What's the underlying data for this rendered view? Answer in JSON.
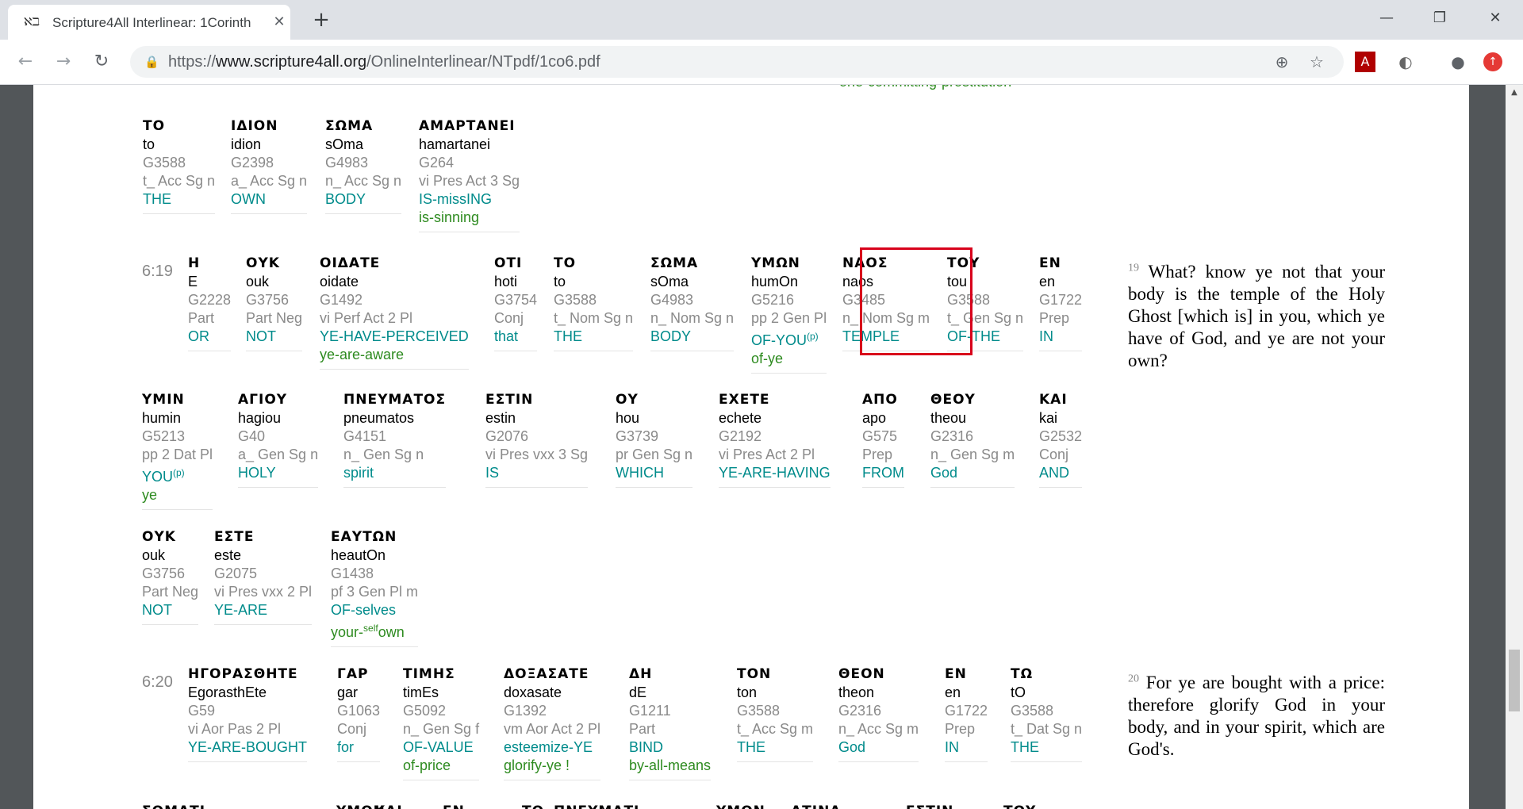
{
  "browser": {
    "tab_title": "Scripture4All Interlinear: 1Corinth",
    "tab_favicon": "ℵℶ",
    "url_scheme": "https://",
    "url_host": "www.scripture4all.org",
    "url_path": "/OnlineInterlinear/NTpdf/1co6.pdf"
  },
  "page": {
    "partial_top_text": "one-committing-prostitution",
    "verses": [
      {
        "ref": "",
        "words": [
          {
            "gk": "ΤΟ",
            "tr": "to",
            "st": "G3588",
            "ps": "t_ Acc Sg n",
            "en": "THE",
            "al": ""
          },
          {
            "gk": "ΙΔΙΟΝ",
            "tr": "idion",
            "st": "G2398",
            "ps": "a_ Acc Sg n",
            "en": "OWN",
            "al": ""
          },
          {
            "gk": "ΣΩΜΑ",
            "tr": "sOma",
            "st": "G4983",
            "ps": "n_ Acc Sg n",
            "en": "BODY",
            "al": ""
          },
          {
            "gk": "ΑΜΑΡΤΑΝΕΙ",
            "tr": "hamartanei",
            "st": "G264",
            "ps": "vi Pres Act 3 Sg",
            "en": "IS-missING",
            "al": "is-sinning"
          }
        ]
      },
      {
        "ref": "6:19",
        "words": [
          {
            "gk": "Η",
            "tr": "E",
            "st": "G2228",
            "ps": "Part",
            "en": "OR",
            "al": ""
          },
          {
            "gk": "ΟΥΚ",
            "tr": "ouk",
            "st": "G3756",
            "ps": "Part Neg",
            "en": "NOT",
            "al": ""
          },
          {
            "gk": "ΟΙΔΑΤΕ",
            "tr": "oidate",
            "st": "G1492",
            "ps": "vi Perf Act 2 Pl",
            "en": "YE-HAVE-PERCEIVED",
            "al": "ye-are-aware"
          },
          {
            "gk": "ΟΤΙ",
            "tr": "hoti",
            "st": "G3754",
            "ps": "Conj",
            "en": "that",
            "al": ""
          },
          {
            "gk": "ΤΟ",
            "tr": "to",
            "st": "G3588",
            "ps": "t_ Nom Sg n",
            "en": "THE",
            "al": ""
          },
          {
            "gk": "ΣΩΜΑ",
            "tr": "sOma",
            "st": "G4983",
            "ps": "n_ Nom Sg n",
            "en": "BODY",
            "al": ""
          },
          {
            "gk": "ΥΜΩΝ",
            "tr": "humOn",
            "st": "G5216",
            "ps": "pp 2 Gen Pl",
            "en": "OF-YOU(p)",
            "al": "of-ye"
          },
          {
            "gk": "ΝΑΟΣ",
            "tr": "naos",
            "st": "G3485",
            "ps": "n_ Nom Sg m",
            "en": "TEMPLE",
            "al": ""
          },
          {
            "gk": "ΤΟΥ",
            "tr": "tou",
            "st": "G3588",
            "ps": "t_ Gen Sg n",
            "en": "OF-THE",
            "al": ""
          },
          {
            "gk": "ΕΝ",
            "tr": "en",
            "st": "G1722",
            "ps": "Prep",
            "en": "IN",
            "al": ""
          }
        ],
        "kjv_num": "19",
        "kjv": "What? know ye not that your body is the temple of the Holy Ghost [which is] in you, which ye have of God, and ye are not your own?"
      },
      {
        "ref": "",
        "words": [
          {
            "gk": "ΥΜΙΝ",
            "tr": "humin",
            "st": "G5213",
            "ps": "pp 2 Dat Pl",
            "en": "YOU(p)",
            "al": "ye"
          },
          {
            "gk": "ΑΓΙΟΥ",
            "tr": "hagiou",
            "st": "G40",
            "ps": "a_ Gen Sg n",
            "en": "HOLY",
            "al": ""
          },
          {
            "gk": "ΠΝΕΥΜΑΤΟΣ",
            "tr": "pneumatos",
            "st": "G4151",
            "ps": "n_ Gen Sg n",
            "en": "spirit",
            "al": ""
          },
          {
            "gk": "ΕΣΤΙΝ",
            "tr": "estin",
            "st": "G2076",
            "ps": "vi Pres vxx 3 Sg",
            "en": "IS",
            "al": ""
          },
          {
            "gk": "ΟΥ",
            "tr": "hou",
            "st": "G3739",
            "ps": "pr Gen Sg n",
            "en": "WHICH",
            "al": ""
          },
          {
            "gk": "ΕΧΕΤΕ",
            "tr": "echete",
            "st": "G2192",
            "ps": "vi Pres Act 2 Pl",
            "en": "YE-ARE-HAVING",
            "al": ""
          },
          {
            "gk": "ΑΠΟ",
            "tr": "apo",
            "st": "G575",
            "ps": "Prep",
            "en": "FROM",
            "al": ""
          },
          {
            "gk": "ΘΕΟΥ",
            "tr": "theou",
            "st": "G2316",
            "ps": "n_ Gen Sg m",
            "en": "God",
            "al": ""
          },
          {
            "gk": "ΚΑΙ",
            "tr": "kai",
            "st": "G2532",
            "ps": "Conj",
            "en": "AND",
            "al": ""
          }
        ]
      },
      {
        "ref": "",
        "words": [
          {
            "gk": "ΟΥΚ",
            "tr": "ouk",
            "st": "G3756",
            "ps": "Part Neg",
            "en": "NOT",
            "al": ""
          },
          {
            "gk": "ΕΣΤΕ",
            "tr": "este",
            "st": "G2075",
            "ps": "vi Pres vxx 2 Pl",
            "en": "YE-ARE",
            "al": ""
          },
          {
            "gk": "ΕΑΥΤΩΝ",
            "tr": "heautOn",
            "st": "G1438",
            "ps": "pf 3 Gen Pl m",
            "en": "OF-selves",
            "al": "your-selfown"
          }
        ]
      },
      {
        "ref": "6:20",
        "words": [
          {
            "gk": "ΗΓΟΡΑΣΘΗΤΕ",
            "tr": "EgorasthEte",
            "st": "G59",
            "ps": "vi Aor Pas 2 Pl",
            "en": "YE-ARE-BOUGHT",
            "al": ""
          },
          {
            "gk": "ΓΑΡ",
            "tr": "gar",
            "st": "G1063",
            "ps": "Conj",
            "en": "for",
            "al": ""
          },
          {
            "gk": "ΤΙΜΗΣ",
            "tr": "timEs",
            "st": "G5092",
            "ps": "n_ Gen Sg f",
            "en": "OF-VALUE",
            "al": "of-price"
          },
          {
            "gk": "ΔΟΞΑΣΑΤΕ",
            "tr": "doxasate",
            "st": "G1392",
            "ps": "vm Aor Act 2 Pl",
            "en": "esteemize-YE",
            "al": "glorify-ye !"
          },
          {
            "gk": "ΔΗ",
            "tr": "dE",
            "st": "G1211",
            "ps": "Part",
            "en": "BIND",
            "al": "by-all-means"
          },
          {
            "gk": "ΤΟΝ",
            "tr": "ton",
            "st": "G3588",
            "ps": "t_ Acc Sg m",
            "en": "THE",
            "al": ""
          },
          {
            "gk": "ΘΕΟΝ",
            "tr": "theon",
            "st": "G2316",
            "ps": "n_ Acc Sg m",
            "en": "God",
            "al": ""
          },
          {
            "gk": "ΕΝ",
            "tr": "en",
            "st": "G1722",
            "ps": "Prep",
            "en": "IN",
            "al": ""
          },
          {
            "gk": "ΤΩ",
            "tr": "tO",
            "st": "G3588",
            "ps": "t_ Dat Sg n",
            "en": "THE",
            "al": ""
          }
        ],
        "kjv_num": "20",
        "kjv": "For ye are bought with a price: therefore glorify God in your body, and in your spirit, which are God's."
      },
      {
        "ref": "",
        "words": [
          {
            "gk": "ΣΩΜΑΤΙ",
            "tr": "",
            "st": "",
            "ps": "",
            "en": "",
            "al": ""
          },
          {
            "gk": "ΥΜΩΝ",
            "tr": "",
            "st": "",
            "ps": "",
            "en": "",
            "al": ""
          },
          {
            "gk": "ΚΑΙ",
            "tr": "",
            "st": "",
            "ps": "",
            "en": "",
            "al": ""
          },
          {
            "gk": "ΕΝ",
            "tr": "",
            "st": "",
            "ps": "",
            "en": "",
            "al": ""
          },
          {
            "gk": "ΤΩ",
            "tr": "",
            "st": "",
            "ps": "",
            "en": "",
            "al": ""
          },
          {
            "gk": "ΠΝΕΥΜΑΤΙ",
            "tr": "",
            "st": "",
            "ps": "",
            "en": "",
            "al": ""
          },
          {
            "gk": "ΥΜΩΝ",
            "tr": "",
            "st": "",
            "ps": "",
            "en": "",
            "al": ""
          },
          {
            "gk": "ΑΤΙΝΑ",
            "tr": "",
            "st": "",
            "ps": "",
            "en": "",
            "al": ""
          },
          {
            "gk": "ΕΣΤΙΝ",
            "tr": "",
            "st": "",
            "ps": "",
            "en": "",
            "al": ""
          },
          {
            "gk": "ΤΟΥ",
            "tr": "",
            "st": "",
            "ps": "",
            "en": "",
            "al": ""
          }
        ]
      }
    ]
  }
}
